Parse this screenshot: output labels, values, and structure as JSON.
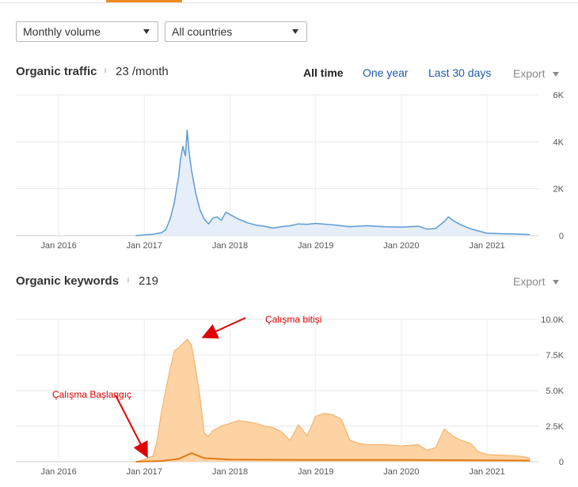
{
  "filters": {
    "volume": "Monthly volume",
    "country": "All countries"
  },
  "traffic": {
    "title": "Organic traffic",
    "info": "i",
    "value": "23 /month",
    "ranges": [
      "All time",
      "One year",
      "Last 30 days"
    ],
    "active_range": "All time",
    "export_label": "Export"
  },
  "keywords": {
    "title": "Organic keywords",
    "info": "i",
    "value": "219",
    "export_label": "Export"
  },
  "colors": {
    "traffic_line": "#5b9bd5",
    "traffic_fill": "#e6eef9",
    "keywords_fill": "#fdd3a4",
    "keywords_line": "#f6b26b",
    "keywords_top": "#e07b14",
    "annotation": "#e00000",
    "tab_accent": "#f08c1e"
  },
  "chart_data": [
    {
      "type": "area",
      "name": "organic-traffic",
      "x_tick_labels": [
        "Jan 2016",
        "Jan 2017",
        "Jan 2018",
        "Jan 2019",
        "Jan 2020",
        "Jan 2021"
      ],
      "y_tick_labels": [
        "0",
        "2K",
        "4K",
        "6K"
      ],
      "ylim": [
        0,
        6000
      ],
      "xlim": [
        2015.5,
        2021.6
      ],
      "grid": true,
      "series": [
        {
          "x": [
            2016.9,
            2017.0,
            2017.1,
            2017.2,
            2017.25,
            2017.3,
            2017.35,
            2017.38,
            2017.4,
            2017.42,
            2017.45,
            2017.48,
            2017.5,
            2017.52,
            2017.55,
            2017.6,
            2017.65,
            2017.7,
            2017.75,
            2017.8,
            2017.85,
            2017.9,
            2017.95,
            2018.0,
            2018.1,
            2018.2,
            2018.3,
            2018.4,
            2018.5,
            2018.6,
            2018.7,
            2018.8,
            2018.9,
            2019.0,
            2019.2,
            2019.4,
            2019.6,
            2019.8,
            2020.0,
            2020.2,
            2020.3,
            2020.4,
            2020.5,
            2020.55,
            2020.6,
            2020.7,
            2020.8,
            2020.9,
            2021.0,
            2021.2,
            2021.4,
            2021.5
          ],
          "y": [
            0,
            30,
            60,
            120,
            250,
            700,
            1400,
            2100,
            2500,
            3200,
            3800,
            3400,
            4500,
            3600,
            2800,
            1800,
            1100,
            700,
            500,
            750,
            800,
            650,
            1000,
            900,
            700,
            550,
            450,
            400,
            320,
            380,
            420,
            500,
            480,
            520,
            460,
            380,
            420,
            380,
            360,
            400,
            280,
            300,
            600,
            800,
            650,
            450,
            300,
            200,
            100,
            80,
            60,
            40
          ]
        }
      ]
    },
    {
      "type": "area",
      "name": "organic-keywords",
      "x_tick_labels": [
        "Jan 2016",
        "Jan 2017",
        "Jan 2018",
        "Jan 2019",
        "Jan 2020",
        "Jan 2021"
      ],
      "y_tick_labels": [
        "0",
        "2.5K",
        "5.0K",
        "7.5K",
        "10.0K"
      ],
      "ylim": [
        0,
        10000
      ],
      "xlim": [
        2015.5,
        2021.6
      ],
      "grid": true,
      "series": [
        {
          "x": [
            2016.9,
            2017.0,
            2017.1,
            2017.15,
            2017.2,
            2017.25,
            2017.3,
            2017.35,
            2017.4,
            2017.45,
            2017.5,
            2017.55,
            2017.6,
            2017.65,
            2017.7,
            2017.75,
            2017.8,
            2017.9,
            2018.0,
            2018.1,
            2018.2,
            2018.3,
            2018.4,
            2018.5,
            2018.6,
            2018.7,
            2018.8,
            2018.85,
            2018.9,
            2019.0,
            2019.1,
            2019.2,
            2019.3,
            2019.4,
            2019.5,
            2019.6,
            2019.8,
            2020.0,
            2020.2,
            2020.3,
            2020.4,
            2020.5,
            2020.6,
            2020.7,
            2020.8,
            2020.9,
            2021.0,
            2021.2,
            2021.4,
            2021.5
          ],
          "y": [
            0,
            150,
            400,
            1500,
            3500,
            5000,
            6500,
            7800,
            8000,
            8300,
            8600,
            8200,
            6500,
            4500,
            2000,
            1800,
            2200,
            2500,
            2700,
            2900,
            2800,
            2700,
            2500,
            2400,
            2100,
            1500,
            2600,
            2200,
            1800,
            3200,
            3400,
            3300,
            3000,
            1500,
            1300,
            1200,
            1200,
            1100,
            1200,
            800,
            1000,
            2300,
            1800,
            1500,
            1300,
            700,
            500,
            450,
            380,
            250
          ]
        },
        {
          "x": [
            2016.9,
            2017.2,
            2017.4,
            2017.55,
            2017.7,
            2018.0,
            2019.0,
            2020.0,
            2021.0,
            2021.5
          ],
          "y": [
            0,
            50,
            200,
            600,
            250,
            150,
            120,
            120,
            100,
            80
          ]
        }
      ]
    }
  ],
  "annotations": {
    "end": "Çalışma bitişi",
    "start": "Çalışma Başlangıç"
  }
}
